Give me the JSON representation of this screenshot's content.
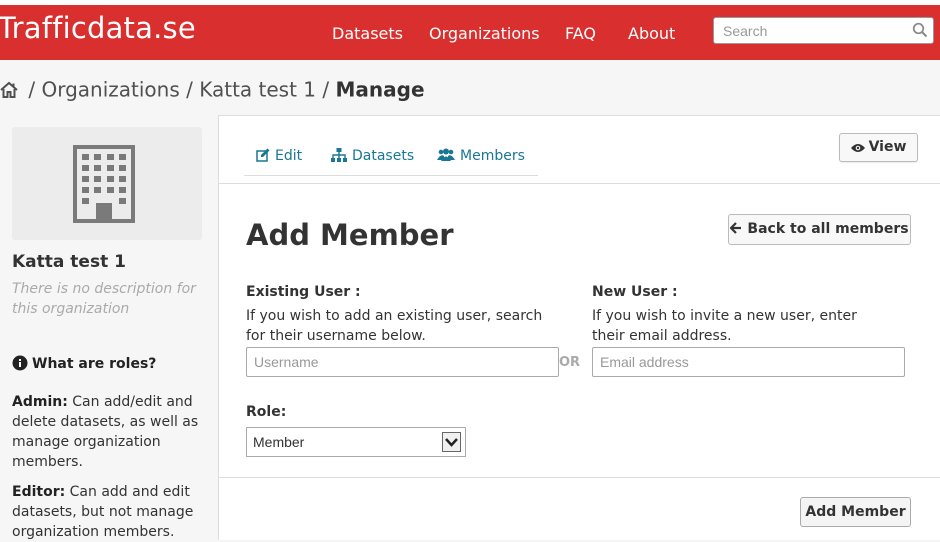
{
  "site": {
    "logo": "Trafficdata.se",
    "brand_color": "#d92f2f"
  },
  "nav": {
    "items": [
      "Datasets",
      "Organizations",
      "FAQ",
      "About"
    ]
  },
  "search": {
    "placeholder": "Search"
  },
  "breadcrumb": {
    "sep": "/",
    "organizations": "Organizations",
    "org": "Katta test 1",
    "current": "Manage"
  },
  "sidebar": {
    "org_name": "Katta test 1",
    "org_desc": "There is no description for this organization",
    "roles_heading": "What are roles?",
    "roles": [
      {
        "name": "Admin:",
        "desc": " Can add/edit and delete datasets, as well as manage organization members."
      },
      {
        "name": "Editor:",
        "desc": " Can add and edit datasets, but not manage organization members."
      }
    ]
  },
  "tabs": {
    "edit": "Edit",
    "datasets": "Datasets",
    "members": "Members"
  },
  "actions": {
    "view": "View",
    "back": "Back to all members",
    "add_member": "Add Member"
  },
  "form": {
    "title": "Add Member",
    "existing_label": "Existing User :",
    "existing_help": "If you wish to add an existing user, search for their username below.",
    "username_placeholder": "Username",
    "or": "OR",
    "new_label": "New User :",
    "new_help": "If you wish to invite a new user, enter their email address.",
    "email_placeholder": "Email address",
    "role_label": "Role:",
    "role_value": "Member"
  }
}
